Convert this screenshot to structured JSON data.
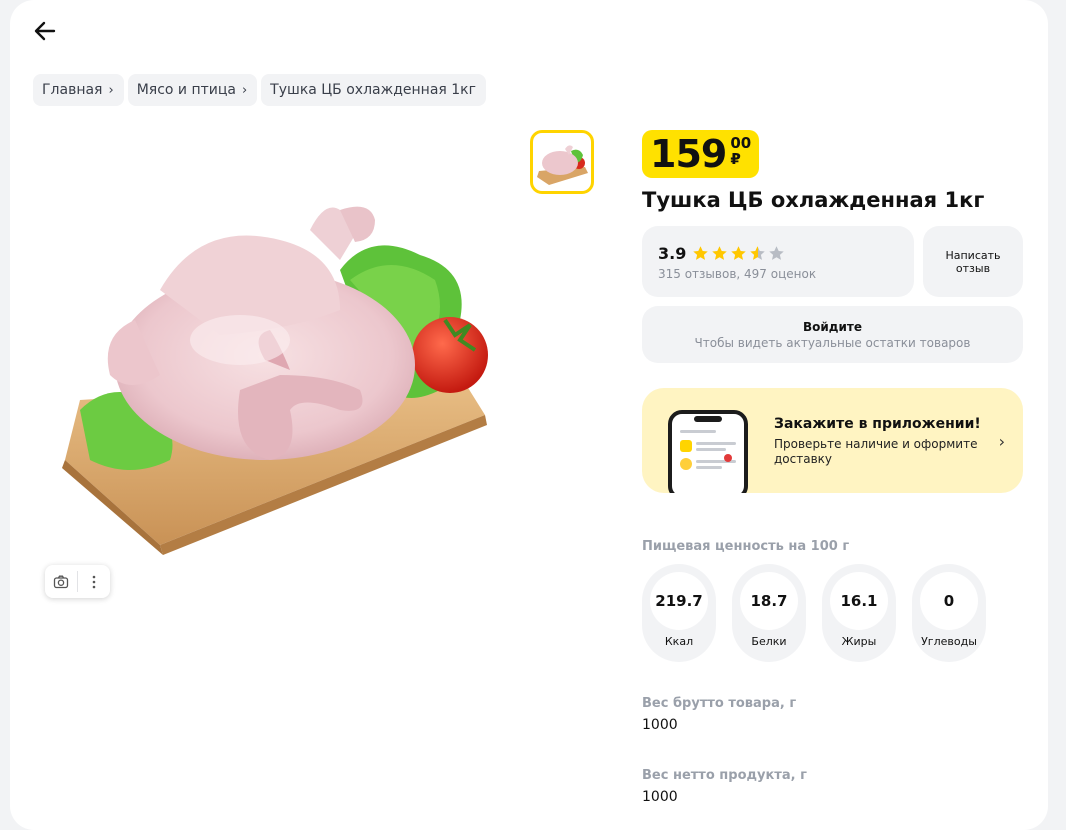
{
  "nav": {
    "back_icon": "arrow-left-icon"
  },
  "breadcrumbs": [
    {
      "label": "Главная"
    },
    {
      "label": "Мясо и птица"
    },
    {
      "label": "Тушка ЦБ охлажденная 1кг"
    }
  ],
  "product": {
    "price_rub": "159",
    "price_kop": "00",
    "currency": "₽",
    "title": "Тушка ЦБ охлажденная 1кг",
    "rating": "3.9",
    "rating_value": 3.9,
    "reviews_text": "315 отзывов, 497 оценок",
    "write_review": "Написать отзыв"
  },
  "login": {
    "title": "Войдите",
    "subtitle": "Чтобы видеть актуальные остатки товаров"
  },
  "promo": {
    "title": "Закажите в приложении!",
    "description": "Проверьте наличие и оформите доставку"
  },
  "nutrition": {
    "title": "Пищевая ценность на 100 г",
    "items": [
      {
        "value": "219.7",
        "label": "Ккал"
      },
      {
        "value": "18.7",
        "label": "Белки"
      },
      {
        "value": "16.1",
        "label": "Жиры"
      },
      {
        "value": "0",
        "label": "Углеводы"
      }
    ]
  },
  "attributes": [
    {
      "title": "Вес брутто товара, г",
      "value": "1000"
    },
    {
      "title": "Вес нетто продукта, г",
      "value": "1000"
    }
  ],
  "colors": {
    "accent": "#ffe100",
    "thumb_border": "#ffd400",
    "promo_bg": "#fff4c2",
    "star": "#ffc700",
    "star_empty": "#b8bcc4"
  }
}
